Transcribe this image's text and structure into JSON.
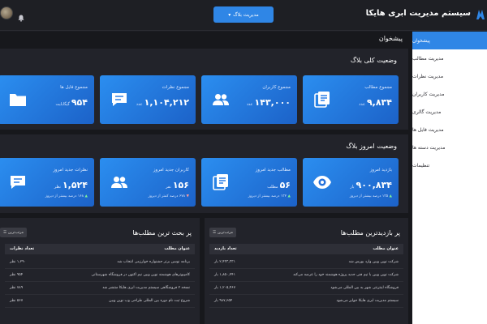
{
  "app": {
    "title": "سیستم مدیریت ابری هایکا"
  },
  "header": {
    "blog_select": "مدیریت بلاگ"
  },
  "sidebar": {
    "items": [
      {
        "label": "پیشخوان",
        "active": true
      },
      {
        "label": "مدیریت مطالب"
      },
      {
        "label": "مدیریت نظرات"
      },
      {
        "label": "مدیریت کاربران"
      },
      {
        "label": "مدیریت گالری"
      },
      {
        "label": "مدیریت فایل ها"
      },
      {
        "label": "مدیریت دسته ها"
      },
      {
        "label": "تنظیمات"
      }
    ]
  },
  "page": {
    "title": "پیشخوان"
  },
  "overall": {
    "title": "وضعیت کلی بلاگ",
    "cards": [
      {
        "label": "مجموع مطالب",
        "value": "۹,۸۳۴",
        "unit": "عدد",
        "icon": "document-stack-icon"
      },
      {
        "label": "مجموع کاربران",
        "value": "۱۴۳,۰۰۰",
        "unit": "عدد",
        "icon": "users-icon"
      },
      {
        "label": "مجموع نظرات",
        "value": "۱,۱۰۴,۲۱۲",
        "unit": "عدد",
        "icon": "comment-icon"
      },
      {
        "label": "مجموع فایل ها",
        "value": "۹۵۴",
        "unit": "گیگابایت",
        "icon": "folder-icon"
      }
    ]
  },
  "today": {
    "title": "وضعیت امروز بلاگ",
    "cards": [
      {
        "label": "بازدید امروز",
        "value": "۹۰۰,۸۳۴",
        "unit": "بار",
        "sub": "۱۳۵ درصد بیشتر از دیروز",
        "trend": "up",
        "icon": "eye-icon"
      },
      {
        "label": "مطالب جدید امروز",
        "value": "۵۶",
        "unit": "مطلب",
        "sub": "۱۳۲ درصد بیشتر از دیروز",
        "trend": "up",
        "icon": "document-stack-icon"
      },
      {
        "label": "کاربران جدید امروز",
        "value": "۱۵۶",
        "unit": "نفر",
        "sub": "۶۷۸ درصد کمتر از دیروز",
        "trend": "down",
        "icon": "users-icon"
      },
      {
        "label": "نظرات جدید امروز",
        "value": "۱,۵۲۴",
        "unit": "نظر",
        "sub": "۱۶۸ درصد بیشتر از دیروز",
        "trend": "up",
        "icon": "comment-icon"
      }
    ]
  },
  "most_viewed": {
    "title": "پر بازدیدترین مطلب‌ها",
    "sort": "مرتب‌ترین",
    "headers": {
      "title": "عنوان مطلب",
      "count": "تعداد بازدید"
    },
    "rows": [
      {
        "title": "شرکت نوین وبین وارد بورس شد",
        "count": "۲,۴۳۳,۳۳۱ بار"
      },
      {
        "title": "شرکت نوین وبین با تیم فنی جدید پروژه هوشمند خود را عرضه می‌کند",
        "count": "۱,۸۵۰,۲۴۱ بار"
      },
      {
        "title": "فروشگاه اینترنتی شهر به بین المللی می‌شود",
        "count": "۱,۲۰۵,۴۶۷ بار"
      },
      {
        "title": "سیستم مدیریت ابری هایکا جوایز می‌شود",
        "count": "۹۸۷,۶۵۴ بار"
      }
    ]
  },
  "most_discussed": {
    "title": "پر بحث ترین مطلب‌ها",
    "sort": "مرتب‌ترین",
    "headers": {
      "title": "عنوان مطلب",
      "count": "تعداد نظرات"
    },
    "rows": [
      {
        "title": "برنامه نوسن برتر جشنواره خوارزمی انتخاب شد",
        "count": "۱,۲۹۰ نظر"
      },
      {
        "title": "کامپیوترهای هوشمند نوین وبین نیم اکنون در فروشگاه شهرستانی",
        "count": "۹۵۴ نظر"
      },
      {
        "title": "نسخه ۲ فروشگاهی سیستم مدیریت ابری هایکا منتشر شد",
        "count": "۷۸۹ نظر"
      },
      {
        "title": "شروع ثبت نام دوره بین المللی طراحی وب نوین وبین",
        "count": "۵۶۷ نظر"
      }
    ]
  },
  "colors": {
    "accent": "#2f86e6",
    "card_start": "#2b8ef0",
    "card_end": "#1c62c8",
    "background": "#17181c",
    "panel": "#22232a"
  }
}
